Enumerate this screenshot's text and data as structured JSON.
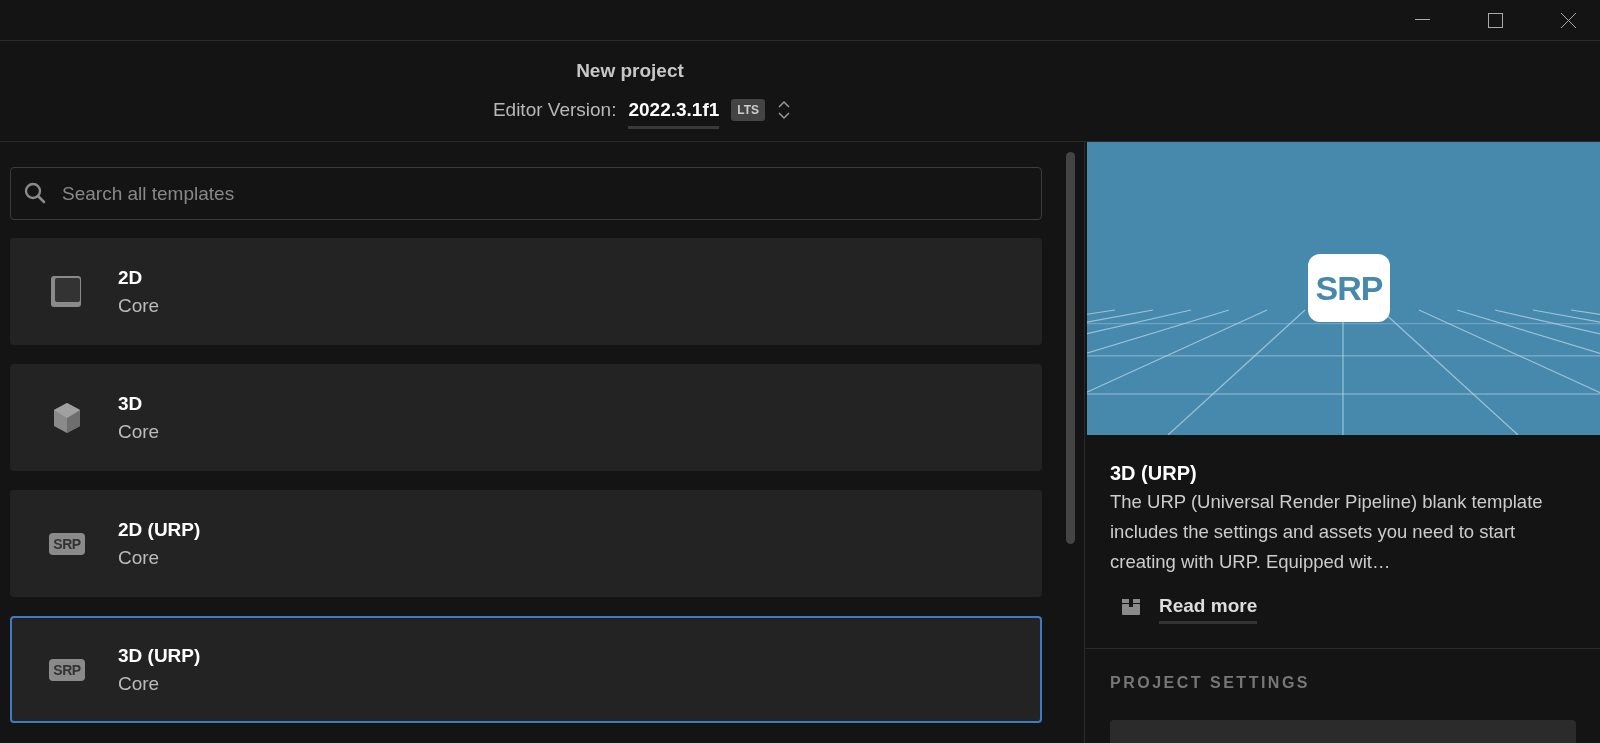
{
  "header": {
    "title": "New project",
    "version_label": "Editor Version:",
    "version": "2022.3.1f1",
    "version_badge": "LTS"
  },
  "search": {
    "placeholder": "Search all templates"
  },
  "templates": [
    {
      "kind": "square",
      "name": "2D",
      "category": "Core",
      "selected": false
    },
    {
      "kind": "cube",
      "name": "3D",
      "category": "Core",
      "selected": false
    },
    {
      "kind": "badge",
      "badge": "SRP",
      "name": "2D (URP)",
      "category": "Core",
      "selected": false
    },
    {
      "kind": "badge",
      "badge": "SRP",
      "name": "3D (URP)",
      "category": "Core",
      "selected": true
    }
  ],
  "details": {
    "preview_badge": "SRP",
    "title": "3D (URP)",
    "description": "The URP (Universal Render Pipeline) blank template includes the settings and assets you need to start creating with URP. Equipped wit…",
    "link": "Read more",
    "section": "PROJECT SETTINGS"
  }
}
